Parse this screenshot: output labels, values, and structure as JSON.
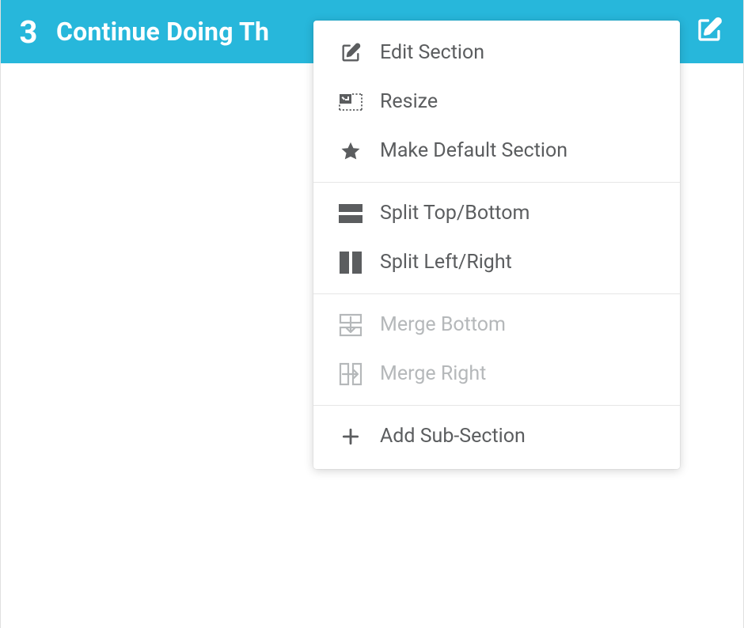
{
  "colors": {
    "accent": "#27b7db",
    "text_primary": "#5b5d5f",
    "text_disabled": "#b5b8ba",
    "white": "#ffffff"
  },
  "section": {
    "number": "3",
    "title": "Continue Doing Th"
  },
  "menu": {
    "items": [
      {
        "label": "Edit Section",
        "icon": "edit-icon",
        "disabled": false
      },
      {
        "label": "Resize",
        "icon": "resize-icon",
        "disabled": false
      },
      {
        "label": "Make Default Section",
        "icon": "star-icon",
        "disabled": false
      }
    ],
    "split_items": [
      {
        "label": "Split Top/Bottom",
        "icon": "split-horizontal-icon",
        "disabled": false
      },
      {
        "label": "Split Left/Right",
        "icon": "split-vertical-icon",
        "disabled": false
      }
    ],
    "merge_items": [
      {
        "label": "Merge Bottom",
        "icon": "merge-bottom-icon",
        "disabled": true
      },
      {
        "label": "Merge Right",
        "icon": "merge-right-icon",
        "disabled": true
      }
    ],
    "add_items": [
      {
        "label": "Add Sub-Section",
        "icon": "plus-icon",
        "disabled": false
      }
    ]
  }
}
